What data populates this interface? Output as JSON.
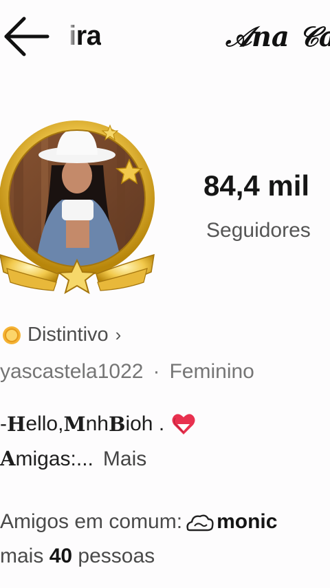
{
  "header": {
    "back_icon": "arrow-left-icon",
    "name_left": "ira",
    "name_right": "𝒜na 𝒞a"
  },
  "profile": {
    "followers_count": "84,4 mil",
    "followers_label": "Seguidores"
  },
  "badge": {
    "icon": "badge-coin-icon",
    "label": "Distintivo",
    "chevron": "›",
    "color": "#f0a020"
  },
  "user": {
    "username": "yascastela1022",
    "separator": "·",
    "gender": "Feminino"
  },
  "bio": {
    "line1_prefix": "- ",
    "line1_bold": "H",
    "line1_text1": "ello, ",
    "line1_bold2": "M",
    "line1_text2": "nh ",
    "line1_bold3": "B",
    "line1_text3": "ioh . ",
    "heart_icon": "heart-emoji-icon",
    "line2_bold": "A",
    "line2_text": "migas:...",
    "more_label": "Mais"
  },
  "mutual": {
    "label": "Amigos em comum:",
    "friend_icon": "cloud-hand-icon",
    "friend_name": "monic",
    "more_prefix": "mais ",
    "more_count": "40",
    "more_suffix": " pessoas"
  }
}
